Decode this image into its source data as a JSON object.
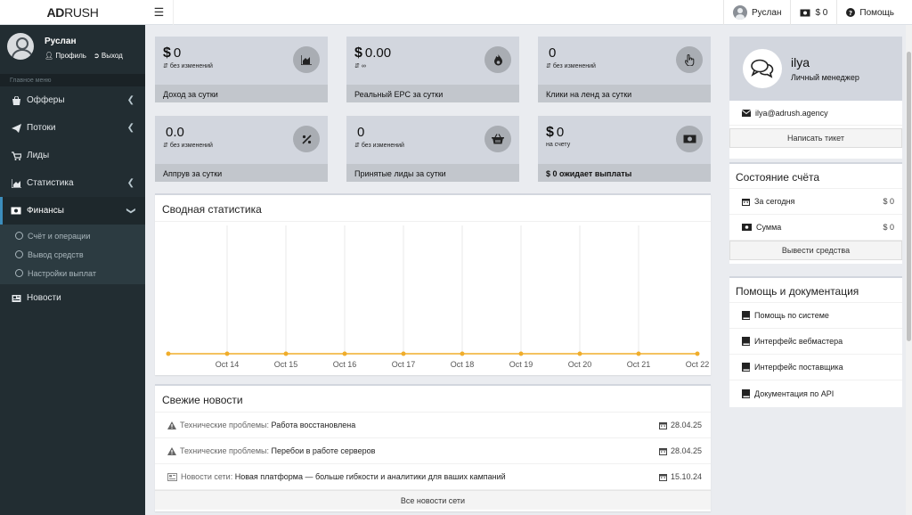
{
  "topbar": {
    "logo_bold": "AD",
    "logo_rest": "RUSH",
    "user_name": "Руслан",
    "balance": "$ 0",
    "help": "Помощь"
  },
  "sidebar": {
    "user_name": "Руслан",
    "profile_link": "Профиль",
    "logout_link": "Выход",
    "section_header": "Главное меню",
    "items": [
      {
        "label": "Офферы"
      },
      {
        "label": "Потоки"
      },
      {
        "label": "Лиды"
      },
      {
        "label": "Статистика"
      },
      {
        "label": "Финансы"
      },
      {
        "label": "Новости"
      }
    ],
    "finance_sub": [
      {
        "label": "Счёт и операции"
      },
      {
        "label": "Вывод средств"
      },
      {
        "label": "Настройки выплат"
      }
    ]
  },
  "stats": [
    {
      "currency": "$",
      "value": "0",
      "change": "без изменений",
      "footer": "Доход за сутки",
      "icon": "area-chart-icon"
    },
    {
      "currency": "$",
      "value": "0.00",
      "change": "∞",
      "footer": "Реальный EPC за сутки",
      "icon": "fire-icon"
    },
    {
      "currency": "",
      "value": "0",
      "change": "без изменений",
      "footer": "Клики на ленд за сутки",
      "icon": "hand-pointer-icon"
    },
    {
      "currency": "",
      "value": "0.0",
      "change": "без изменений",
      "footer": "Аппрув за сутки",
      "icon": "percent-icon"
    },
    {
      "currency": "",
      "value": "0",
      "change": "без изменений",
      "footer": "Принятые лиды за сутки",
      "icon": "basket-icon"
    },
    {
      "currency": "$",
      "value": "0",
      "change": "на счету",
      "footer": "$ 0 ожидает выплаты",
      "icon": "money-icon"
    }
  ],
  "summary": {
    "title": "Сводная статистика"
  },
  "chart_data": {
    "type": "line",
    "categories": [
      "",
      "Oct 14",
      "Oct 15",
      "Oct 16",
      "Oct 17",
      "Oct 18",
      "Oct 19",
      "Oct 20",
      "Oct 21",
      "Oct 22"
    ],
    "series": [
      {
        "values": [
          0,
          0,
          0,
          0,
          0,
          0,
          0,
          0,
          0,
          0
        ],
        "color": "#f0ad2b"
      }
    ],
    "title": "",
    "xlabel": "",
    "ylabel": "",
    "grid": true
  },
  "news": {
    "title": "Свежие новости",
    "items": [
      {
        "category": "Технические проблемы:",
        "title": "Работа восстановлена",
        "date": "28.04.25",
        "icon": "warning-icon"
      },
      {
        "category": "Технические проблемы:",
        "title": "Перебои в работе серверов",
        "date": "28.04.25",
        "icon": "warning-icon"
      },
      {
        "category": "Новости сети:",
        "title": "Новая платформа — больше гибкости и аналитики для ваших кампаний",
        "date": "15.10.24",
        "icon": "newspaper-icon"
      }
    ],
    "all_button": "Все новости сети"
  },
  "manager": {
    "name": "ilya",
    "role": "Личный менеджер",
    "email": "ilya@adrush.agency",
    "ticket_button": "Написать тикет"
  },
  "account": {
    "title": "Состояние счёта",
    "today_label": "За сегодня",
    "today_value": "$ 0",
    "sum_label": "Сумма",
    "sum_value": "$ 0",
    "withdraw_button": "Вывести средства"
  },
  "help": {
    "title": "Помощь и документация",
    "items": [
      {
        "label": "Помощь по системе"
      },
      {
        "label": "Интерфейс вебмастера"
      },
      {
        "label": "Интерфейс поставщика"
      },
      {
        "label": "Документация по API"
      }
    ]
  },
  "colors": {
    "sidebar": "#222d32",
    "accent": "#3c8dbc",
    "box": "#d2d6de",
    "line": "#f0ad2b"
  }
}
